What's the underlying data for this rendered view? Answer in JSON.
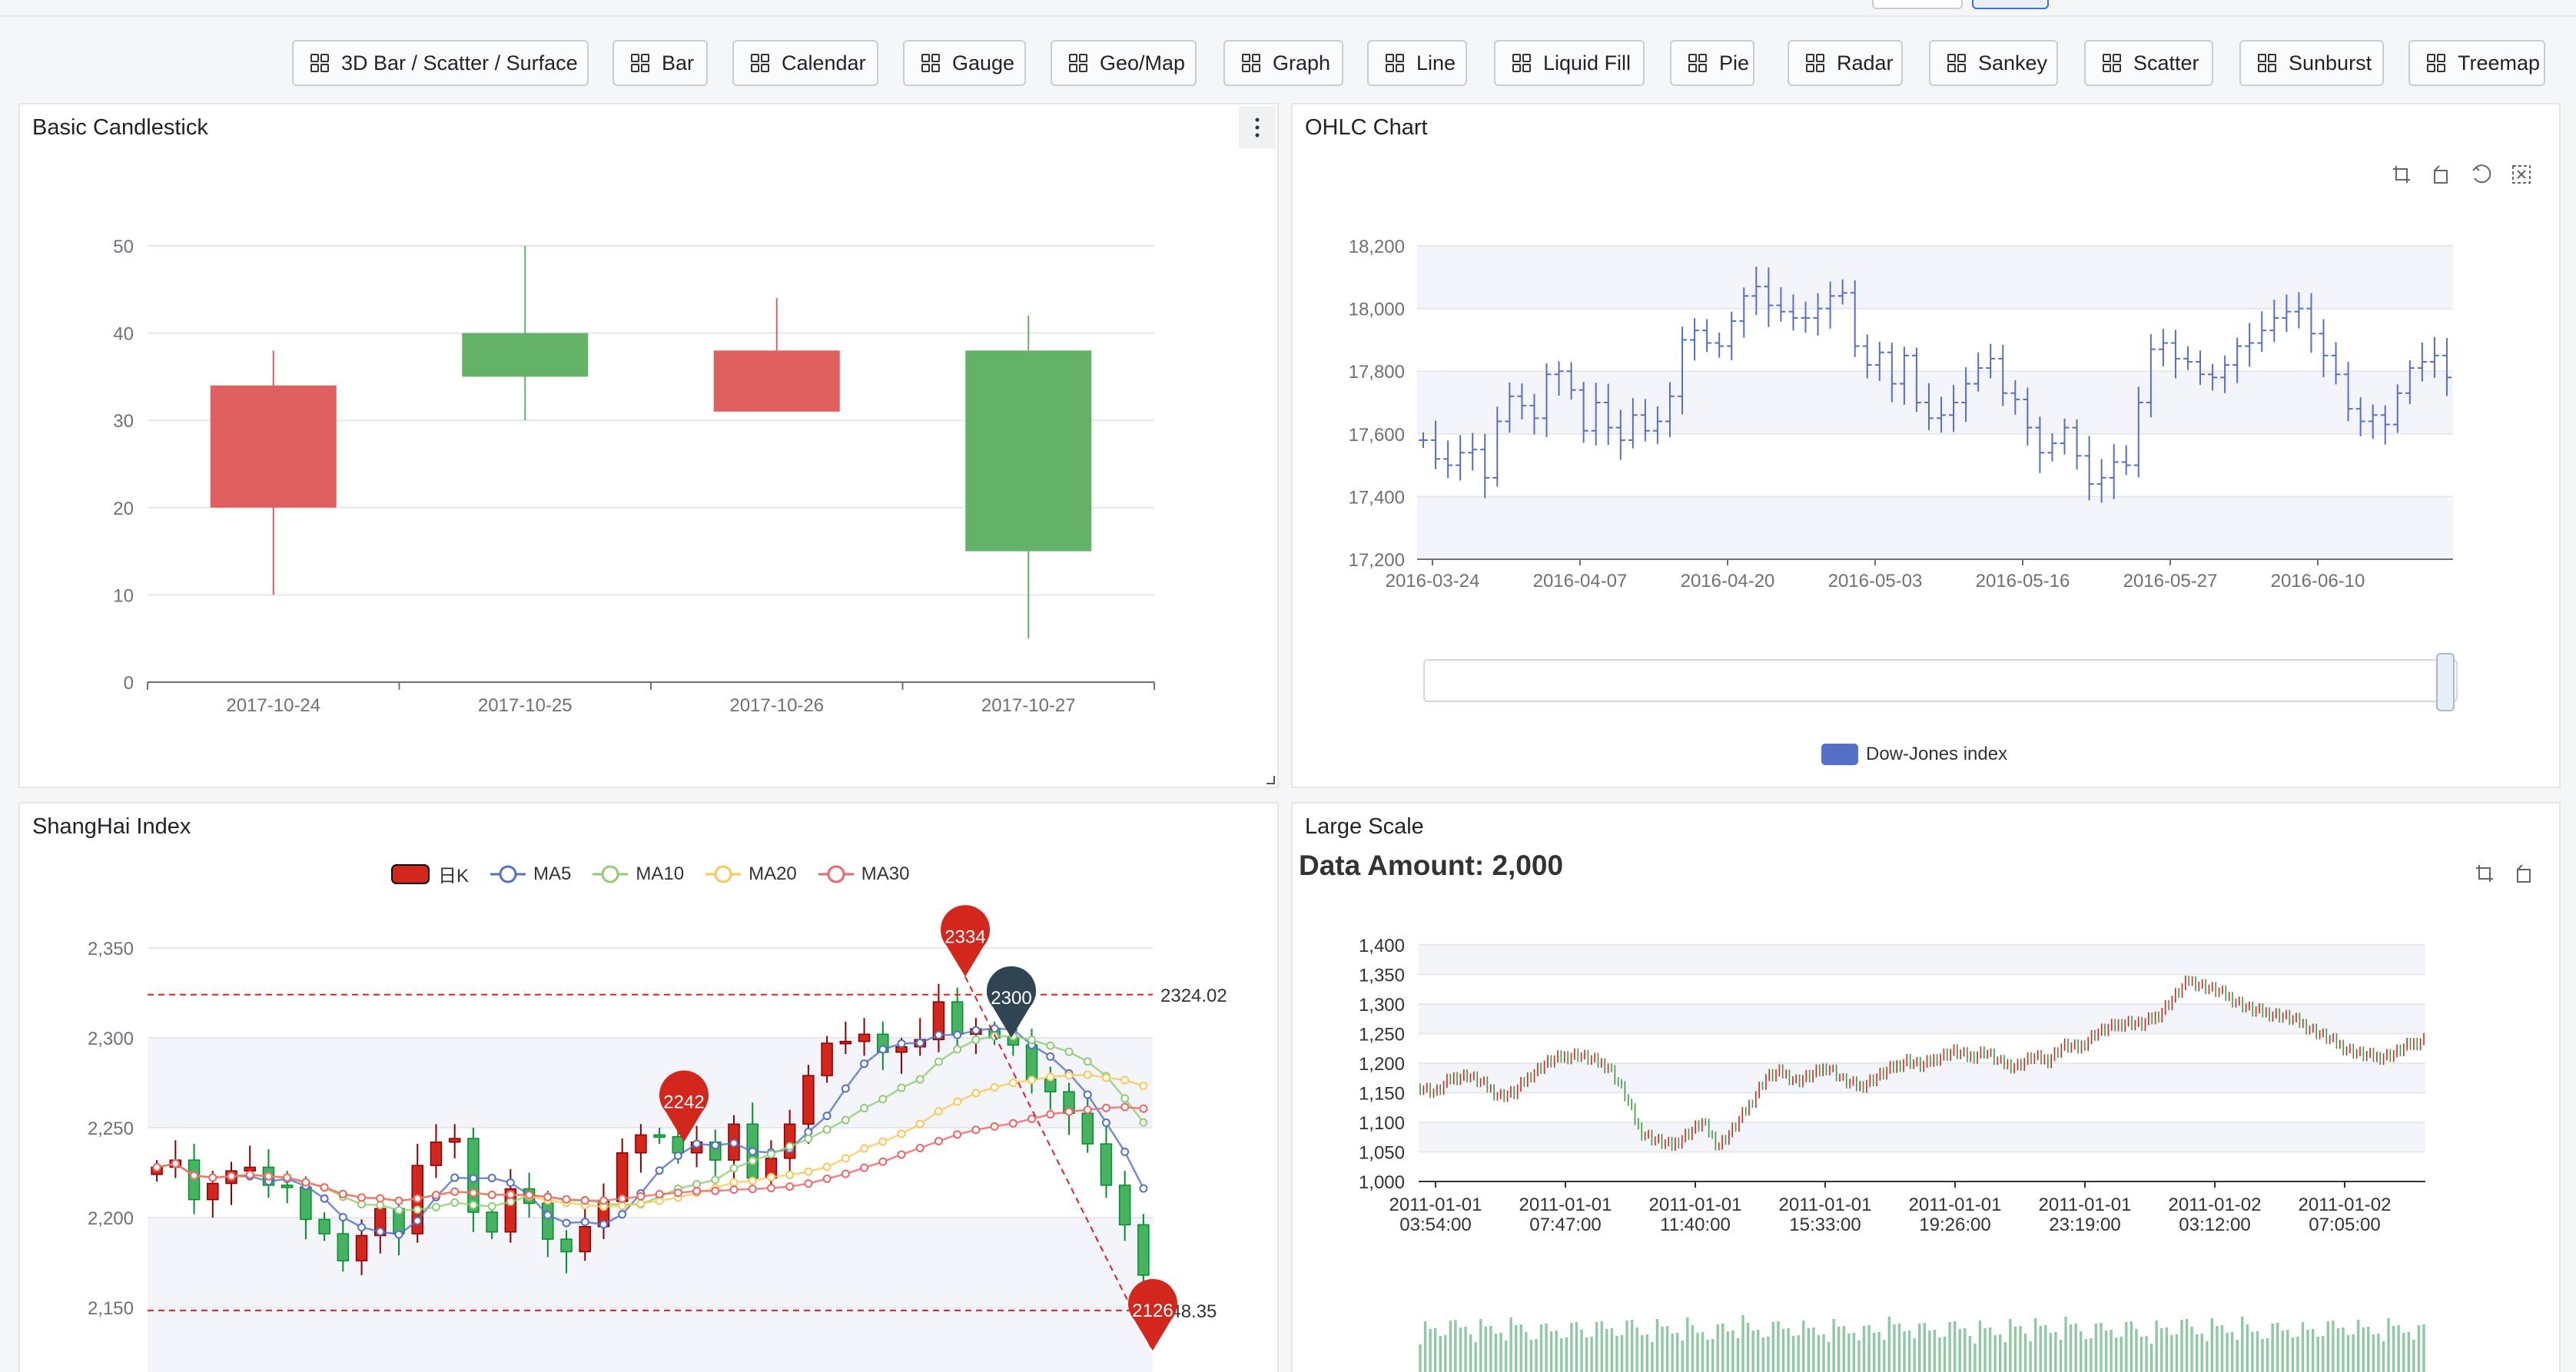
{
  "toolbar": {
    "buttons": [
      "3D Bar / Scatter / Surface",
      "Bar",
      "Calendar",
      "Gauge",
      "Geo/Map",
      "Graph",
      "Line",
      "Liquid Fill",
      "Pie",
      "Radar",
      "Sankey",
      "Scatter",
      "Sunburst",
      "Treemap"
    ]
  },
  "panels": {
    "candlestick": {
      "title": "Basic Candlestick",
      "chart_data": {
        "type": "candlestick",
        "categories": [
          "2017-10-24",
          "2017-10-25",
          "2017-10-26",
          "2017-10-27"
        ],
        "ohlc": [
          [
            20,
            34,
            10,
            38
          ],
          [
            40,
            35,
            30,
            50
          ],
          [
            31,
            38,
            33,
            44
          ],
          [
            38,
            15,
            5,
            42
          ]
        ],
        "ylim": [
          0,
          50
        ],
        "yticks": [
          0,
          10,
          20,
          30,
          40,
          50
        ],
        "colors": {
          "up": "#e06060",
          "down": "#64b268"
        }
      }
    },
    "ohlc": {
      "title": "OHLC Chart",
      "legend": "Dow-Jones index",
      "chart_data": {
        "type": "ohlc",
        "x_ticks": [
          "2016-03-24",
          "2016-04-07",
          "2016-04-20",
          "2016-05-03",
          "2016-05-16",
          "2016-05-27",
          "2016-06-10"
        ],
        "yticks": [
          "17,200",
          "17,400",
          "17,600",
          "17,800",
          "18,000",
          "18,200"
        ],
        "ylim": [
          17200,
          18200
        ],
        "closes": [
          17580,
          17520,
          17500,
          17540,
          17550,
          17460,
          17640,
          17720,
          17690,
          17650,
          17790,
          17800,
          17740,
          17610,
          17700,
          17620,
          17580,
          17660,
          17610,
          17640,
          17720,
          17900,
          17930,
          17890,
          17880,
          17960,
          18040,
          18070,
          18010,
          17990,
          17970,
          17970,
          18000,
          18040,
          18050,
          17880,
          17820,
          17860,
          17760,
          17850,
          17700,
          17650,
          17660,
          17700,
          17760,
          17810,
          17840,
          17730,
          17710,
          17620,
          17540,
          17570,
          17620,
          17530,
          17440,
          17460,
          17510,
          17500,
          17700,
          17870,
          17890,
          17840,
          17830,
          17790,
          17780,
          17820,
          17880,
          17890,
          17930,
          17970,
          17990,
          18000,
          17920,
          17850,
          17790,
          17680,
          17640,
          17660,
          17630,
          17730,
          17810,
          17830,
          17850,
          17780
        ],
        "series_color": "#5470c6",
        "legend_color": "#5470c6"
      }
    },
    "shanghai": {
      "title": "ShangHai Index",
      "legend": [
        "日K",
        "MA5",
        "MA10",
        "MA20",
        "MA30"
      ],
      "legend_colors": [
        "#d3261c",
        "#5470c6",
        "#91cc75",
        "#fac858",
        "#ee6666"
      ],
      "chart_data": {
        "type": "candlestick",
        "yticks": [
          "2,150",
          "2,200",
          "2,250",
          "2,300",
          "2,350"
        ],
        "ylim": [
          2140,
          2370
        ],
        "closes": [
          2228,
          2232,
          2210,
          2219,
          2226,
          2228,
          2218,
          2217,
          2199,
          2191,
          2176,
          2190,
          2205,
          2191,
          2229,
          2242,
          2244,
          2203,
          2192,
          2216,
          2208,
          2188,
          2181,
          2195,
          2209,
          2236,
          2246,
          2245,
          2236,
          2242,
          2232,
          2252,
          2222,
          2233,
          2252,
          2279,
          2297,
          2298,
          2302,
          2292,
          2295,
          2299,
          2320,
          2302,
          2305,
          2300,
          2296,
          2277,
          2270,
          2258,
          2241,
          2218,
          2196,
          2168
        ],
        "mark_points": [
          {
            "label": "2334",
            "value": 2334
          },
          {
            "label": "2300",
            "value": 2300
          },
          {
            "label": "2242",
            "value": 2242
          },
          {
            "label": "2126",
            "value": 2126
          }
        ],
        "mark_lines": [
          {
            "label": "2324.02",
            "value": 2324.02
          },
          {
            "label": "2148.35",
            "value": 2148.35
          }
        ],
        "label_shown_min": "148.35"
      }
    },
    "largescale": {
      "title": "Large Scale",
      "subtitle": "Data Amount: 2,000",
      "chart_data": {
        "type": "candlestick",
        "yticks": [
          "1,000",
          "1,050",
          "1,100",
          "1,150",
          "1,200",
          "1,250",
          "1,300",
          "1,350",
          "1,400"
        ],
        "ylim": [
          1000,
          1400
        ],
        "x_ticks": [
          [
            "2011-01-01",
            "03:54:00"
          ],
          [
            "2011-01-01",
            "07:47:00"
          ],
          [
            "2011-01-01",
            "11:40:00"
          ],
          [
            "2011-01-01",
            "15:33:00"
          ],
          [
            "2011-01-01",
            "19:26:00"
          ],
          [
            "2011-01-01",
            "23:19:00"
          ],
          [
            "2011-01-02",
            "03:12:00"
          ],
          [
            "2011-01-02",
            "07:05:00"
          ]
        ],
        "profile": [
          1160,
          1150,
          1175,
          1180,
          1165,
          1145,
          1150,
          1180,
          1200,
          1210,
          1215,
          1205,
          1195,
          1150,
          1085,
          1070,
          1060,
          1080,
          1100,
          1060,
          1090,
          1130,
          1175,
          1185,
          1170,
          1180,
          1195,
          1170,
          1160,
          1175,
          1190,
          1205,
          1195,
          1210,
          1220,
          1210,
          1220,
          1200,
          1195,
          1210,
          1205,
          1230,
          1225,
          1250,
          1260,
          1270,
          1265,
          1280,
          1310,
          1340,
          1330,
          1320,
          1305,
          1290,
          1285,
          1280,
          1270,
          1255,
          1240,
          1225,
          1215,
          1210,
          1215,
          1230,
          1240
        ],
        "up_color": "#d3261c",
        "down_color": "#3b9a3b",
        "volume_color": "#8fc9a3"
      }
    }
  }
}
